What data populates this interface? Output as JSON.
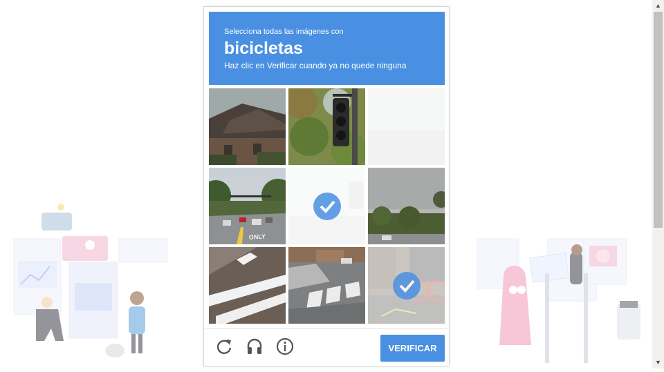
{
  "captcha": {
    "instruction": "Selecciona todas las imágenes con",
    "keyword": "bicicletas",
    "hint": "Haz clic en Verificar cuando ya no quede ninguna",
    "verify_label": "VERIFICAR",
    "tiles": [
      {
        "index": 1,
        "scene": "house-roof",
        "state": "normal"
      },
      {
        "index": 2,
        "scene": "traffic-light-trees",
        "state": "normal"
      },
      {
        "index": 3,
        "scene": "blank",
        "state": "fading"
      },
      {
        "index": 4,
        "scene": "road-traffic",
        "state": "normal"
      },
      {
        "index": 5,
        "scene": "sign-faded",
        "state": "selected"
      },
      {
        "index": 6,
        "scene": "sky-trees",
        "state": "normal"
      },
      {
        "index": 7,
        "scene": "road-markings",
        "state": "normal"
      },
      {
        "index": 8,
        "scene": "crosswalk",
        "state": "normal"
      },
      {
        "index": 9,
        "scene": "bicycle",
        "state": "selected"
      }
    ],
    "road_text": "ONLY",
    "icons": [
      "reload-icon",
      "audio-icon",
      "info-icon"
    ]
  },
  "colors": {
    "accent": "#4a90e2",
    "background": "#ffffff"
  }
}
